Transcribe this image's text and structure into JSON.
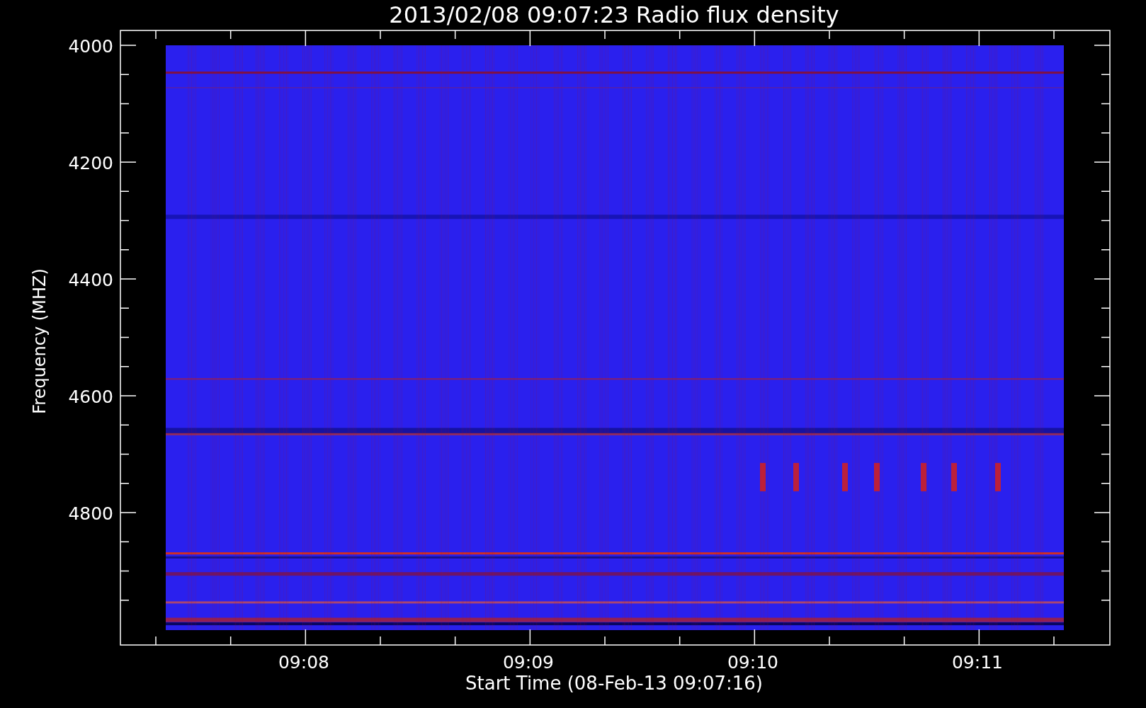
{
  "title": "2013/02/08 09:07:23 Radio flux density",
  "y_axis": {
    "label": "Frequency (MHZ)",
    "ticks": [
      "4000",
      "4200",
      "4400",
      "4600",
      "4800"
    ]
  },
  "x_axis": {
    "label": "Start Time (08-Feb-13 09:07:16)",
    "ticks": [
      "09:08",
      "09:09",
      "09:10",
      "09:11"
    ]
  }
}
